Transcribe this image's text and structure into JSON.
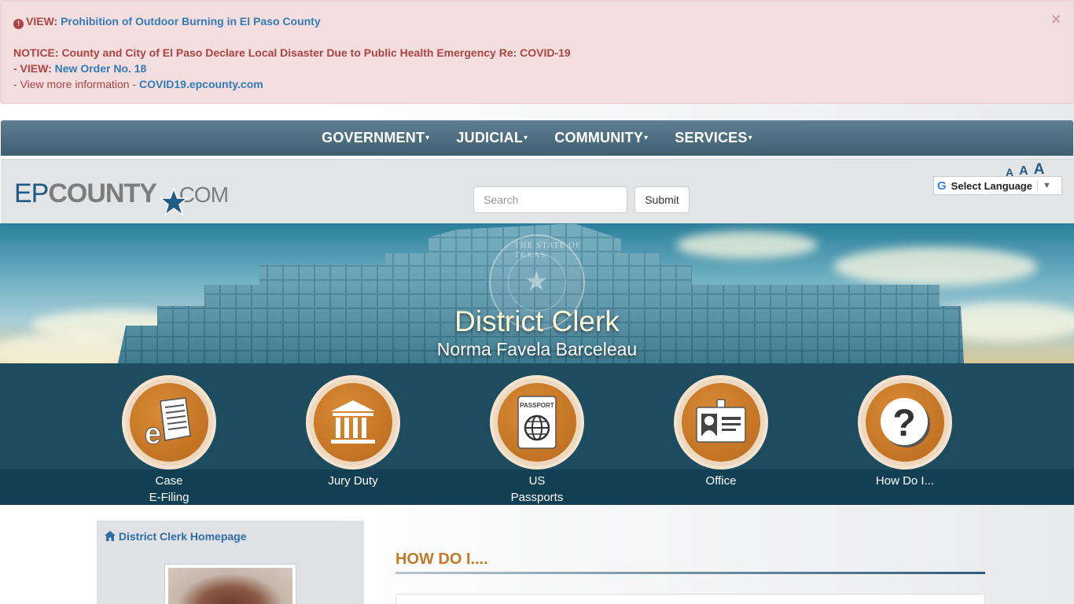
{
  "alert": {
    "line1_prefix": "VIEW:",
    "line1_link": "Prohibition of Outdoor Burning in El Paso County",
    "notice": "NOTICE: County and City of El Paso Declare Local Disaster Due to Public Health Emergency Re: COVID-19",
    "line3_prefix": "- VIEW:",
    "line3_link": "New Order No. 18",
    "line4_prefix": "- View more information -",
    "line4_link": "COVID19.epcounty.com",
    "close": "×"
  },
  "nav": {
    "items": [
      {
        "label": "GOVERNMENT"
      },
      {
        "label": "JUDICIAL"
      },
      {
        "label": "COMMUNITY"
      },
      {
        "label": "SERVICES"
      }
    ]
  },
  "header": {
    "logo": {
      "ep": "EP",
      "county": "COUNTY",
      "com": ".COM"
    },
    "search_placeholder": "Search",
    "submit_label": "Submit",
    "font_sizes": [
      "A",
      "A",
      "A"
    ],
    "language_label": "Select Language"
  },
  "banner": {
    "seal_text": "THE STATE OF TEXAS",
    "title": "District Clerk",
    "subtitle": "Norma Favela Barceleau"
  },
  "quick_links": [
    {
      "line1": "Case",
      "line2": "E-Filing",
      "icon": "efiling-document-icon"
    },
    {
      "line1": "Jury Duty",
      "line2": "",
      "icon": "courthouse-icon"
    },
    {
      "line1": "US",
      "line2": "Passports",
      "icon": "passport-icon"
    },
    {
      "line1": "Office",
      "line2": "",
      "icon": "id-badge-icon"
    },
    {
      "line1": "How Do I...",
      "line2": "",
      "icon": "question-mark-icon"
    }
  ],
  "passport_word": "PASSPORT",
  "sidebar": {
    "home_link": "District Clerk Homepage"
  },
  "main": {
    "section_title": "HOW DO I...."
  },
  "colors": {
    "alert_bg": "#f2dede",
    "alert_text": "#a94442",
    "link": "#337ab7",
    "nav_bg": "#4d6f80",
    "quick_bg": "#1e4c5f",
    "icon_orange": "#c97a28",
    "section_title": "#c07a2a"
  }
}
